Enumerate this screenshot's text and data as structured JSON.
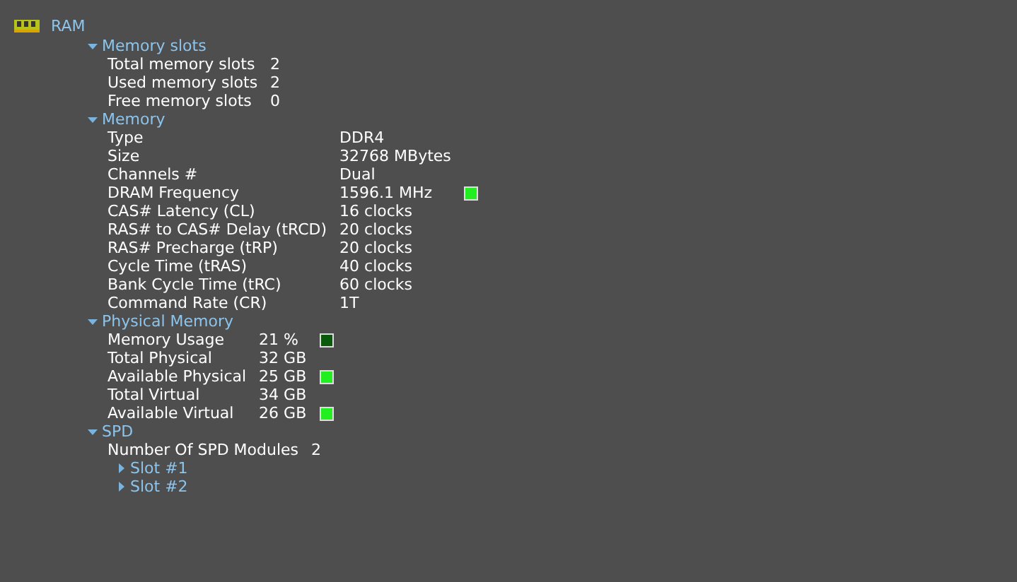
{
  "root": {
    "label": "RAM"
  },
  "sections": [
    {
      "title": "Memory slots",
      "expanded": true,
      "rows": [
        {
          "label": "Total memory slots",
          "value": "2"
        },
        {
          "label": "Used memory slots",
          "value": "2"
        },
        {
          "label": "Free memory slots",
          "value": "0"
        }
      ]
    },
    {
      "title": "Memory",
      "expanded": true,
      "rows": [
        {
          "label": "Type",
          "value": "DDR4"
        },
        {
          "label": "Size",
          "value": "32768 MBytes"
        },
        {
          "label": "Channels #",
          "value": "Dual"
        },
        {
          "label": "DRAM Frequency",
          "value": "1596.1 MHz",
          "indicator_lit": true
        },
        {
          "label": "CAS# Latency (CL)",
          "value": "16 clocks"
        },
        {
          "label": "RAS# to CAS# Delay (tRCD)",
          "value": "20 clocks"
        },
        {
          "label": "RAS# Precharge (tRP)",
          "value": "20 clocks"
        },
        {
          "label": "Cycle Time (tRAS)",
          "value": "40 clocks"
        },
        {
          "label": "Bank Cycle Time (tRC)",
          "value": "60 clocks"
        },
        {
          "label": "Command Rate (CR)",
          "value": "1T"
        }
      ]
    },
    {
      "title": "Physical Memory",
      "expanded": true,
      "rows": [
        {
          "label": "Memory Usage",
          "value": "21 %",
          "indicator_lit": false
        },
        {
          "label": "Total Physical",
          "value": "32 GB"
        },
        {
          "label": "Available Physical",
          "value": "25 GB",
          "indicator_lit": true
        },
        {
          "label": "Total Virtual",
          "value": "34 GB"
        },
        {
          "label": "Available Virtual",
          "value": "26 GB",
          "indicator_lit": true
        }
      ]
    },
    {
      "title": "SPD",
      "expanded": true,
      "rows": [
        {
          "label": "Number Of SPD Modules",
          "value": "2"
        }
      ],
      "children": [
        {
          "title": "Slot #1",
          "expanded": false
        },
        {
          "title": "Slot #2",
          "expanded": false
        }
      ]
    }
  ]
}
